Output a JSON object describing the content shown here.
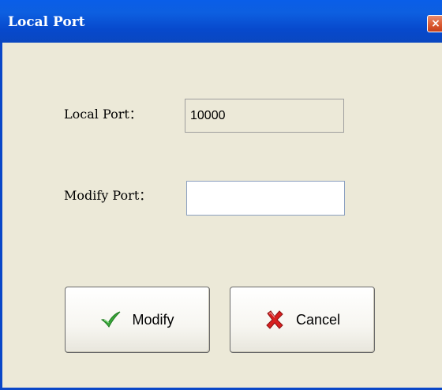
{
  "window": {
    "title": "Local Port",
    "close_glyph": "×"
  },
  "form": {
    "local_port_label": "Local Port：",
    "local_port_value": "10000",
    "modify_port_label": "Modify Port：",
    "modify_port_value": "",
    "modify_port_placeholder": ""
  },
  "buttons": {
    "modify_label": "Modify",
    "modify_icon": "checkmark-icon",
    "cancel_label": "Cancel",
    "cancel_icon": "red-x-icon"
  },
  "colors": {
    "titlebar": "#0a5ee8",
    "window_bg": "#ece9d8",
    "check_green": "#3aa83a",
    "cancel_red": "#d82020"
  }
}
